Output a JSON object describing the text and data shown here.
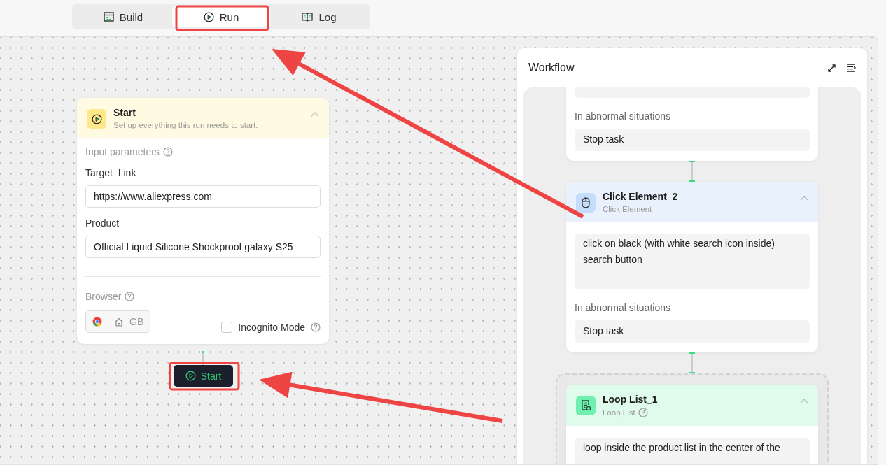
{
  "tabs": [
    {
      "label": "Build",
      "kind": "build",
      "selected": false
    },
    {
      "label": "Run",
      "kind": "run",
      "selected": true
    },
    {
      "label": "Log",
      "kind": "log",
      "selected": false
    }
  ],
  "start_node": {
    "title": "Start",
    "subtitle": "Set up everything this run needs to start.",
    "expanded": true,
    "params_label": "Input parameters",
    "params": [
      {
        "label": "Target_Link",
        "value": "https://www.aliexpress.com"
      },
      {
        "label": "Product",
        "value": "Official Liquid Silicone Shockproof galaxy S25"
      }
    ],
    "browser_label": "Browser",
    "browser_chip": "GB",
    "incognito": {
      "label": "Incognito Mode",
      "checked": false
    }
  },
  "run_button": "Start",
  "workflow": {
    "title": "Workflow",
    "nodes": [
      {
        "kind": "step",
        "abnormal_label": "In abnormal situations",
        "abnormal_value": "Stop task"
      },
      {
        "kind": "click",
        "title": "Click Element_2",
        "subtitle": "Click Element",
        "expanded": true,
        "instruction": "click on black (with white search icon inside) search button",
        "abnormal_label": "In abnormal situations",
        "abnormal_value": "Stop task"
      },
      {
        "kind": "loop",
        "title": "Loop List_1",
        "subtitle": "Loop List",
        "expanded": true,
        "instruction": "loop inside the product list in the center of the"
      }
    ]
  }
}
